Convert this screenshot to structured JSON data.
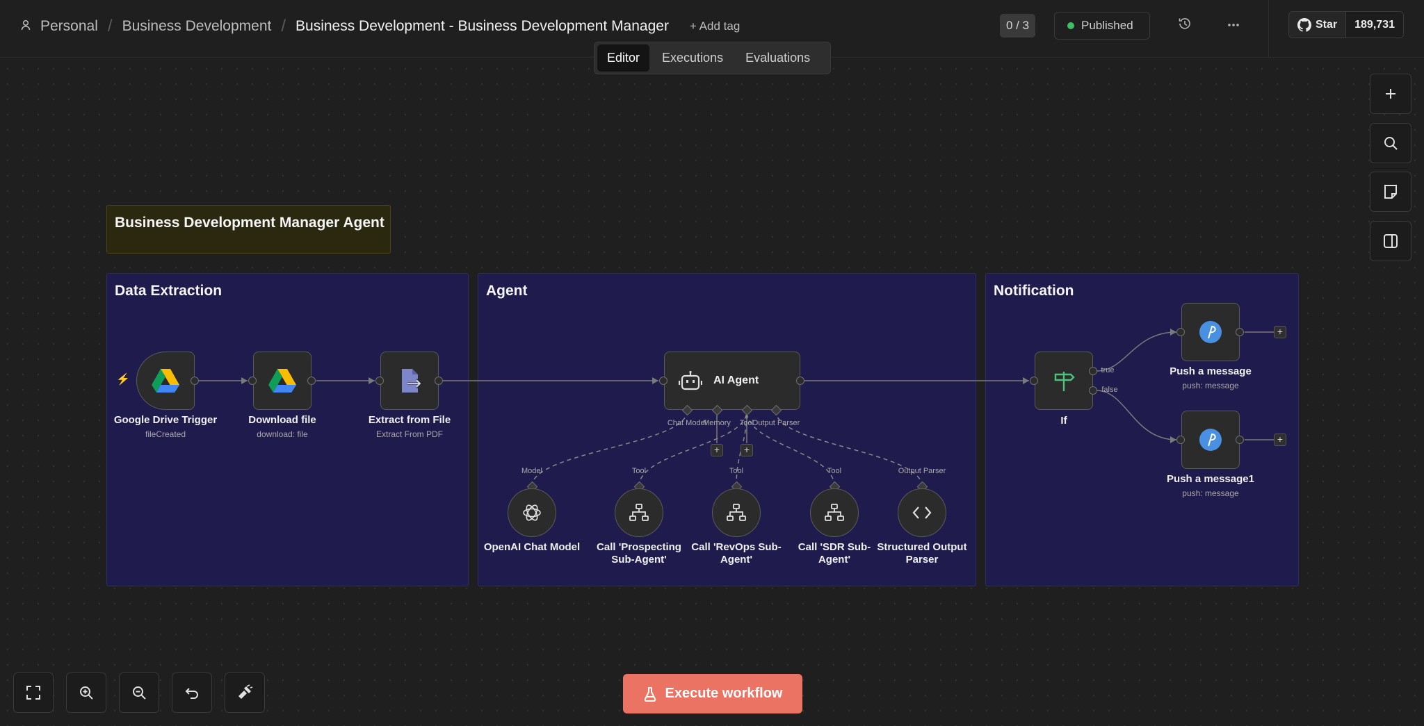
{
  "breadcrumb": {
    "workspace": "Personal",
    "folder": "Business Development",
    "workflow": "Business Development - Business Development Manager",
    "add_tag": "+ Add tag"
  },
  "tabs": [
    {
      "label": "Editor",
      "active": true
    },
    {
      "label": "Executions",
      "active": false
    },
    {
      "label": "Evaluations",
      "active": false
    }
  ],
  "header": {
    "counter": "0 / 3",
    "status": "Published",
    "github_star": "Star",
    "github_count": "189,731"
  },
  "sticky": {
    "title": "Business Development Manager Agent"
  },
  "groups": {
    "data_extraction": "Data Extraction",
    "agent": "Agent",
    "notification": "Notification"
  },
  "nodes": {
    "gdrive_trigger": {
      "label": "Google Drive Trigger",
      "sub": "fileCreated"
    },
    "download_file": {
      "label": "Download file",
      "sub": "download: file"
    },
    "extract_file": {
      "label": "Extract from File",
      "sub": "Extract From PDF"
    },
    "ai_agent": {
      "label": "AI Agent"
    },
    "openai_model": {
      "label": "OpenAI Chat Model",
      "handle": "Model"
    },
    "call_prospecting": {
      "label_1": "Call 'Prospecting",
      "label_2": "Sub-Agent'",
      "handle": "Tool"
    },
    "call_revops": {
      "label_1": "Call 'RevOps Sub-",
      "label_2": "Agent'",
      "handle": "Tool"
    },
    "call_sdr": {
      "label_1": "Call 'SDR Sub-",
      "label_2": "Agent'",
      "handle": "Tool"
    },
    "output_parser": {
      "label_1": "Structured Output",
      "label_2": "Parser",
      "handle": "Output Parser"
    },
    "if_node": {
      "label": "If",
      "true": "true",
      "false": "false"
    },
    "push_message": {
      "label": "Push a message",
      "sub": "push: message"
    },
    "push_message1": {
      "label": "Push a message1",
      "sub": "push: message"
    }
  },
  "agent_handles": {
    "chat_model": "Chat Model",
    "memory": "Memory",
    "tool": "Tool",
    "output_parser": "Output Parser"
  },
  "actions": {
    "execute": "Execute workflow"
  },
  "colors": {
    "canvas": "#1f1f1f",
    "group_fill": "#1f1c4d",
    "sticky_fill": "#2b2810",
    "execute_button": "#ea7363",
    "published_dot": "#3fbf65",
    "pushover_blue": "#4a90e2"
  }
}
